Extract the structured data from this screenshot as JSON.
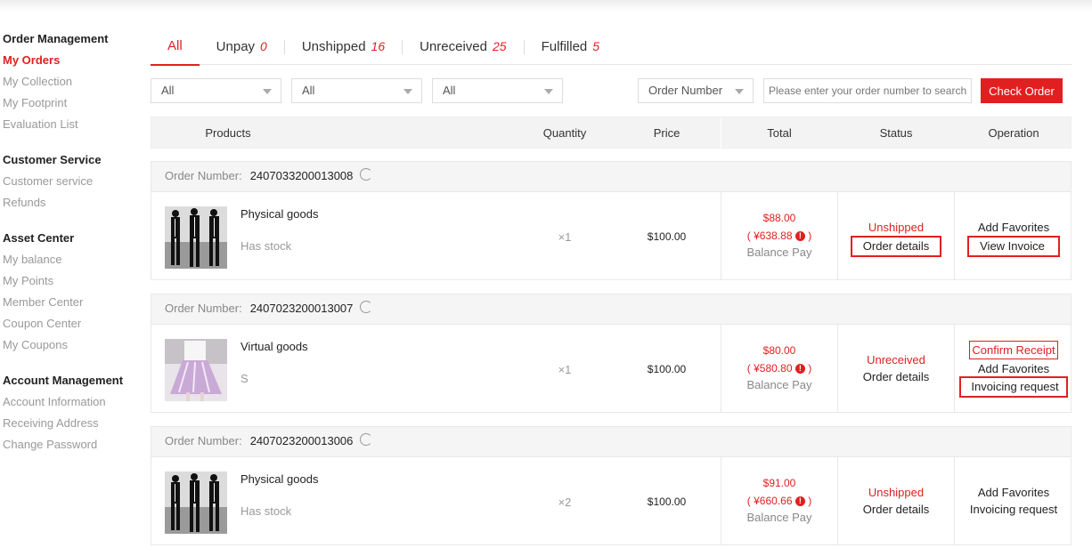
{
  "sidebar": {
    "groups": [
      {
        "title": "Order Management",
        "items": [
          "My Orders",
          "My Collection",
          "My Footprint",
          "Evaluation List"
        ]
      },
      {
        "title": "Customer Service",
        "items": [
          "Customer service",
          "Refunds"
        ]
      },
      {
        "title": "Asset Center",
        "items": [
          "My balance",
          "My Points",
          "Member Center",
          "Coupon Center",
          "My Coupons"
        ]
      },
      {
        "title": "Account Management",
        "items": [
          "Account Information",
          "Receiving Address",
          "Change Password"
        ]
      }
    ],
    "active_item": "My Orders"
  },
  "tabs": [
    {
      "label": "All",
      "count": ""
    },
    {
      "label": "Unpay",
      "count": "0"
    },
    {
      "label": "Unshipped",
      "count": "16"
    },
    {
      "label": "Unreceived",
      "count": "25"
    },
    {
      "label": "Fulfilled",
      "count": "5"
    }
  ],
  "filters": {
    "select1": "All",
    "select2": "All",
    "select3": "All",
    "search_type": "Order Number",
    "search_placeholder": "Please enter your order number to search",
    "check_button": "Check Order"
  },
  "table_headers": {
    "products": "Products",
    "quantity": "Quantity",
    "price": "Price",
    "total": "Total",
    "status": "Status",
    "operation": "Operation"
  },
  "order_number_label": "Order Number:",
  "orders": [
    {
      "number": "2407033200013008",
      "product": "Physical goods",
      "spec": "Has stock",
      "qty": "×1",
      "price": "$100.00",
      "total": "$88.00",
      "total_cny": "( ¥638.88",
      "total_cny_close": ")",
      "pay": "Balance Pay",
      "status": "Unshipped",
      "status_link": "Order details",
      "op1": "Add Favorites",
      "op2": "View Invoice"
    },
    {
      "number": "2407023200013007",
      "product": "Virtual goods",
      "spec": "S",
      "qty": "×1",
      "price": "$100.00",
      "total": "$80.00",
      "total_cny": "( ¥580.80",
      "total_cny_close": ")",
      "pay": "Balance Pay",
      "status": "Unreceived",
      "status_link": "Order details",
      "op0": "Confirm Receipt",
      "op1": "Add Favorites",
      "op2": "Invoicing request"
    },
    {
      "number": "2407023200013006",
      "product": "Physical goods",
      "spec": "Has stock",
      "qty": "×2",
      "price": "$100.00",
      "total": "$91.00",
      "total_cny": "( ¥660.66",
      "total_cny_close": ")",
      "pay": "Balance Pay",
      "status": "Unshipped",
      "status_link": "Order details",
      "op1": "Add Favorites",
      "op2": "Invoicing request"
    }
  ],
  "colors": {
    "accent": "#e02020",
    "muted": "#999999"
  }
}
